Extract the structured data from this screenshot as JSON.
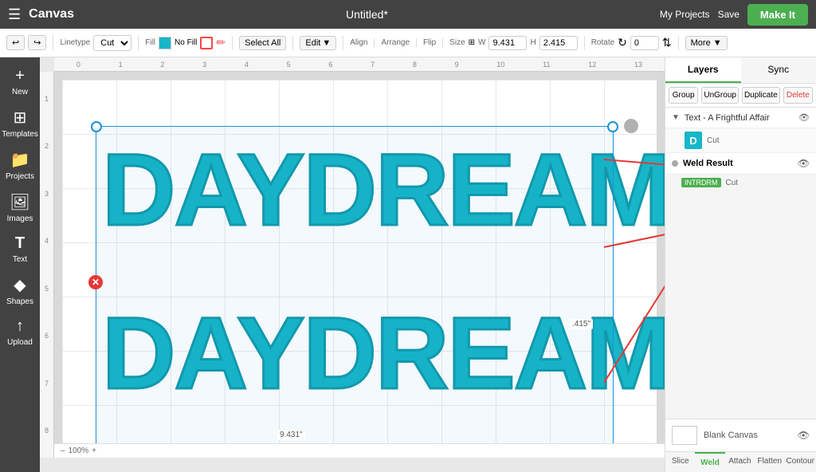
{
  "topbar": {
    "menu_icon": "☰",
    "app_title": "Canvas",
    "doc_title": "Untitled*",
    "my_projects_label": "My Projects",
    "save_label": "Save",
    "make_it_label": "Make It"
  },
  "toolbar": {
    "undo_label": "↩",
    "redo_label": "↪",
    "linetype_label": "Linetype",
    "linetype_value": "Cut",
    "fill_label": "Fill",
    "fill_value": "No Fill",
    "select_all_label": "Select All",
    "edit_label": "Edit",
    "align_label": "Align",
    "arrange_label": "Arrange",
    "flip_label": "Flip",
    "size_label": "Size",
    "width_label": "W",
    "width_value": "9.431",
    "height_label": "H",
    "height_value": "2.415",
    "rotate_label": "Rotate",
    "rotate_value": "0",
    "more_label": "More ▼"
  },
  "sidebar": {
    "items": [
      {
        "icon": "+",
        "label": "New"
      },
      {
        "icon": "⊞",
        "label": "Templates"
      },
      {
        "icon": "🖼",
        "label": "Projects"
      },
      {
        "icon": "🖼",
        "label": "Images"
      },
      {
        "icon": "T",
        "label": "Text"
      },
      {
        "icon": "◆",
        "label": "Shapes"
      },
      {
        "icon": "↑",
        "label": "Upload"
      }
    ]
  },
  "canvas": {
    "text_top": "DAYDREAM",
    "text_bottom": "DAYDREAM",
    "dimension_width": "9.431\"",
    "dimension_height": ".415\"",
    "zoom_level": "100%",
    "ruler_h": [
      "0",
      "1",
      "2",
      "3",
      "4",
      "5",
      "6",
      "7",
      "8",
      "9",
      "10",
      "11",
      "12",
      "13"
    ],
    "ruler_v": [
      "1",
      "2",
      "3",
      "4",
      "5",
      "6",
      "7",
      "8"
    ]
  },
  "layers_panel": {
    "tabs": [
      {
        "label": "Layers"
      },
      {
        "label": "Sync"
      }
    ],
    "actions": [
      {
        "label": "Group"
      },
      {
        "label": "UnGroup"
      },
      {
        "label": "Duplicate"
      },
      {
        "label": "Delete"
      }
    ],
    "items": [
      {
        "type": "group",
        "name": "Text - A Frightful Affair",
        "expanded": true,
        "children": [
          {
            "thumb_letter": "D",
            "cut_label": "Cut"
          }
        ]
      },
      {
        "type": "weld",
        "name": "Weld Result",
        "badge": "INTRDRM",
        "cut_label": "Cut"
      }
    ],
    "blank_canvas_label": "Blank Canvas"
  },
  "bottom_tabs": [
    {
      "label": "Slice"
    },
    {
      "label": "Weld",
      "active": true
    },
    {
      "label": "Attach"
    },
    {
      "label": "Flatten"
    },
    {
      "label": "Contour"
    }
  ]
}
